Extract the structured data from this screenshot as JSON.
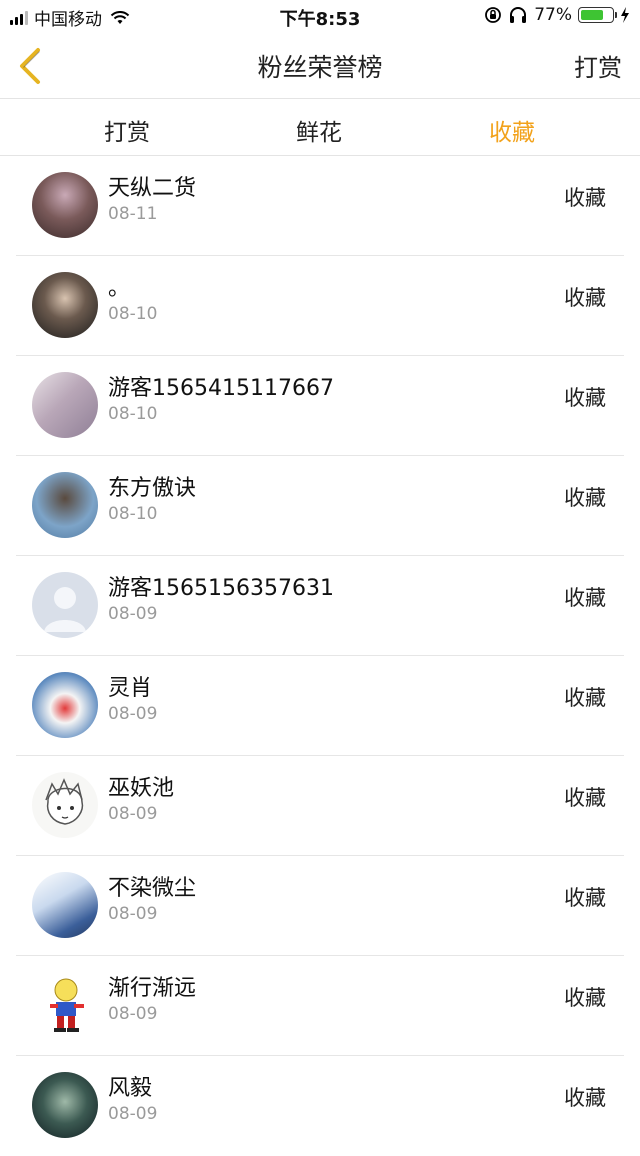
{
  "status": {
    "carrier": "中国移动",
    "time": "下午8:53",
    "battery": "77%",
    "battery_level": 0.77
  },
  "header": {
    "title": "粉丝荣誉榜",
    "action": "打赏",
    "back_icon": "chevron-left-icon",
    "back_color": "#e6b422"
  },
  "tabs": [
    {
      "label": "打赏",
      "active": false
    },
    {
      "label": "鲜花",
      "active": false
    },
    {
      "label": "收藏",
      "active": true
    }
  ],
  "accent_color": "#f2a21b",
  "rows": [
    {
      "name": "天纵二货",
      "date": "08-11",
      "action": "收藏"
    },
    {
      "name": "。",
      "date": "08-10",
      "action": "收藏"
    },
    {
      "name": "游客1565415117667",
      "date": "08-10",
      "action": "收藏"
    },
    {
      "name": "东方傲诀",
      "date": "08-10",
      "action": "收藏"
    },
    {
      "name": "游客1565156357631",
      "date": "08-09",
      "action": "收藏"
    },
    {
      "name": "灵肖",
      "date": "08-09",
      "action": "收藏"
    },
    {
      "name": "巫妖池",
      "date": "08-09",
      "action": "收藏"
    },
    {
      "name": "不染微尘",
      "date": "08-09",
      "action": "收藏"
    },
    {
      "name": "渐行渐远",
      "date": "08-09",
      "action": "收藏"
    },
    {
      "name": "风毅",
      "date": "08-09",
      "action": "收藏"
    }
  ]
}
